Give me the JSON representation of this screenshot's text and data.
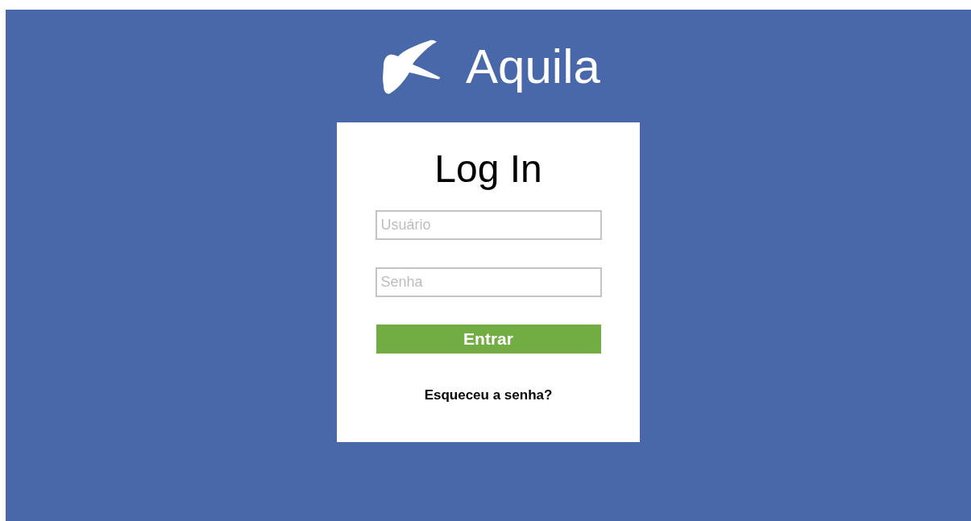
{
  "brand": {
    "name": "Aquila"
  },
  "login": {
    "title": "Log In",
    "fields": [
      {
        "placeholder": "Usuário"
      },
      {
        "placeholder": "Senha"
      }
    ],
    "submit": "Entrar",
    "forgot_link": "Esqueceu a senha?"
  }
}
